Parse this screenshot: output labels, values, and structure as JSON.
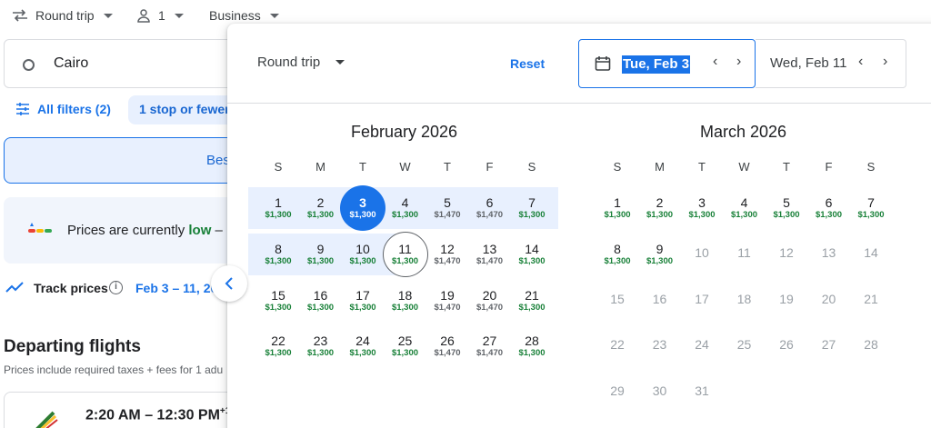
{
  "topbar": {
    "trip_type": "Round trip",
    "passengers": "1",
    "cabin": "Business"
  },
  "origin": {
    "value": "Cairo"
  },
  "filters": {
    "all_filters": "All filters (2)",
    "stops_chip": "1 stop or fewer"
  },
  "tabs": {
    "best": "Bes"
  },
  "price_banner": {
    "prefix": "Prices are currently ",
    "level": "low",
    "suffix": " –"
  },
  "track": {
    "label": "Track prices",
    "dates": "Feb 3 – 11, 20"
  },
  "departing": {
    "title": "Departing flights",
    "subtitle": "Prices include required taxes + fees for 1 adu"
  },
  "flight": {
    "time": "2:20 AM – 12:30 PM",
    "plus_days": "+1"
  },
  "picker": {
    "trip_type": "Round trip",
    "reset": "Reset",
    "departure": "Tue, Feb 3",
    "return": "Wed, Feb 11",
    "weekdays": [
      "S",
      "M",
      "T",
      "W",
      "T",
      "F",
      "S"
    ],
    "months": [
      {
        "title": "February 2026",
        "weeks": [
          [
            [
              "1",
              "$1,300",
              "low"
            ],
            [
              "2",
              "$1,300",
              "low"
            ],
            [
              "3",
              "$1,300",
              "dep"
            ],
            [
              "4",
              "$1,300",
              "low"
            ],
            [
              "5",
              "$1,470",
              "mid"
            ],
            [
              "6",
              "$1,470",
              "mid"
            ],
            [
              "7",
              "$1,300",
              "low"
            ]
          ],
          [
            [
              "8",
              "$1,300",
              "low"
            ],
            [
              "9",
              "$1,300",
              "low"
            ],
            [
              "10",
              "$1,300",
              "low"
            ],
            [
              "11",
              "$1,300",
              "ret"
            ],
            [
              "12",
              "$1,470",
              "mid"
            ],
            [
              "13",
              "$1,470",
              "mid"
            ],
            [
              "14",
              "$1,300",
              "low"
            ]
          ],
          [
            [
              "15",
              "$1,300",
              "low"
            ],
            [
              "16",
              "$1,300",
              "low"
            ],
            [
              "17",
              "$1,300",
              "low"
            ],
            [
              "18",
              "$1,300",
              "low"
            ],
            [
              "19",
              "$1,470",
              "mid"
            ],
            [
              "20",
              "$1,470",
              "mid"
            ],
            [
              "21",
              "$1,300",
              "low"
            ]
          ],
          [
            [
              "22",
              "$1,300",
              "low"
            ],
            [
              "23",
              "$1,300",
              "low"
            ],
            [
              "24",
              "$1,300",
              "low"
            ],
            [
              "25",
              "$1,300",
              "low"
            ],
            [
              "26",
              "$1,470",
              "mid"
            ],
            [
              "27",
              "$1,470",
              "mid"
            ],
            [
              "28",
              "$1,300",
              "low"
            ]
          ]
        ]
      },
      {
        "title": "March 2026",
        "weeks": [
          [
            [
              "1",
              "$1,300",
              "low"
            ],
            [
              "2",
              "$1,300",
              "low"
            ],
            [
              "3",
              "$1,300",
              "low"
            ],
            [
              "4",
              "$1,300",
              "low"
            ],
            [
              "5",
              "$1,300",
              "low"
            ],
            [
              "6",
              "$1,300",
              "low"
            ],
            [
              "7",
              "$1,300",
              "low"
            ]
          ],
          [
            [
              "8",
              "$1,300",
              "low"
            ],
            [
              "9",
              "$1,300",
              "low"
            ],
            [
              "10",
              "",
              "dis"
            ],
            [
              "11",
              "",
              "dis"
            ],
            [
              "12",
              "",
              "dis"
            ],
            [
              "13",
              "",
              "dis"
            ],
            [
              "14",
              "",
              "dis"
            ]
          ],
          [
            [
              "15",
              "",
              "dis"
            ],
            [
              "16",
              "",
              "dis"
            ],
            [
              "17",
              "",
              "dis"
            ],
            [
              "18",
              "",
              "dis"
            ],
            [
              "19",
              "",
              "dis"
            ],
            [
              "20",
              "",
              "dis"
            ],
            [
              "21",
              "",
              "dis"
            ]
          ],
          [
            [
              "22",
              "",
              "dis"
            ],
            [
              "23",
              "",
              "dis"
            ],
            [
              "24",
              "",
              "dis"
            ],
            [
              "25",
              "",
              "dis"
            ],
            [
              "26",
              "",
              "dis"
            ],
            [
              "27",
              "",
              "dis"
            ],
            [
              "28",
              "",
              "dis"
            ]
          ],
          [
            [
              "29",
              "",
              "dis"
            ],
            [
              "30",
              "",
              "dis"
            ],
            [
              "31",
              "",
              "dis"
            ]
          ]
        ]
      }
    ]
  },
  "colors": {
    "accent": "#1a73e8",
    "low_price": "#188038",
    "range_band": "#e8f0fe"
  }
}
